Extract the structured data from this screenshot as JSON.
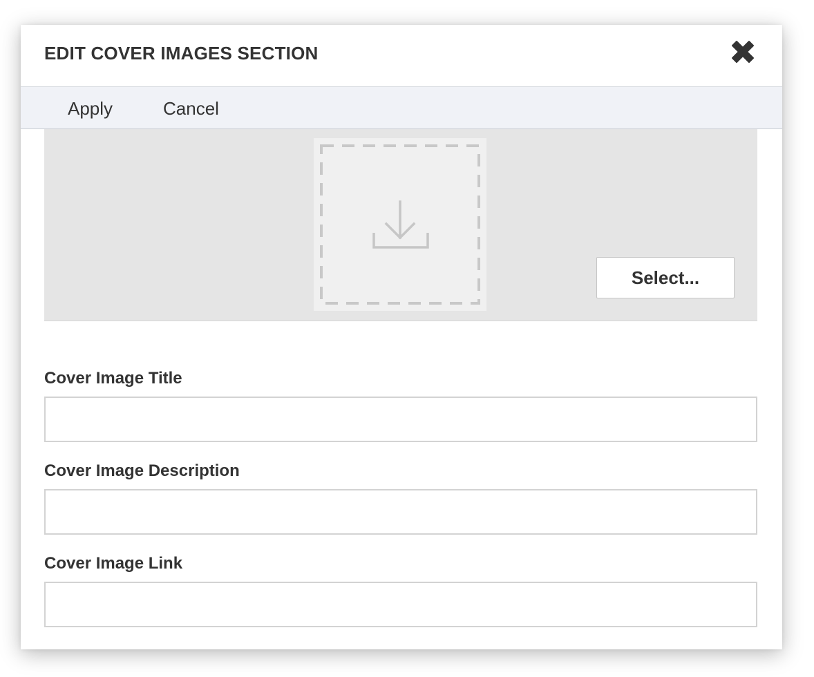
{
  "dialog": {
    "title": "EDIT COVER IMAGES SECTION",
    "close_icon": "close-x-icon"
  },
  "toolbar": {
    "apply_label": "Apply",
    "cancel_label": "Cancel"
  },
  "image_area": {
    "upload_icon": "download-tray-icon",
    "select_label": "Select..."
  },
  "fields": {
    "title": {
      "label": "Cover Image Title",
      "value": "",
      "placeholder": ""
    },
    "description": {
      "label": "Cover Image Description",
      "value": "",
      "placeholder": ""
    },
    "link": {
      "label": "Cover Image Link",
      "value": "",
      "placeholder": ""
    }
  },
  "colors": {
    "toolbar_bg": "#f0f2f7",
    "image_area_bg": "#e5e5e5",
    "dropzone_bg": "#f0f0f0",
    "text": "#333333"
  }
}
